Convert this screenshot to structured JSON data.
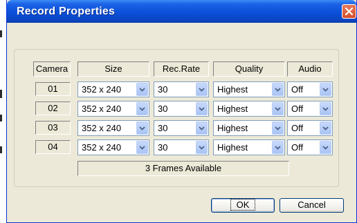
{
  "dialog": {
    "title": "Record Properties",
    "headers": {
      "camera": "Camera",
      "size": "Size",
      "rec_rate": "Rec.Rate",
      "quality": "Quality",
      "audio": "Audio"
    },
    "rows": [
      {
        "camera": "01",
        "size": "352 x 240",
        "rec_rate": "30",
        "quality": "Highest",
        "audio": "Off"
      },
      {
        "camera": "02",
        "size": "352 x 240",
        "rec_rate": "30",
        "quality": "Highest",
        "audio": "Off"
      },
      {
        "camera": "03",
        "size": "352 x 240",
        "rec_rate": "30",
        "quality": "Highest",
        "audio": "Off"
      },
      {
        "camera": "04",
        "size": "352 x 240",
        "rec_rate": "30",
        "quality": "Highest",
        "audio": "Off"
      }
    ],
    "status": "3 Frames Available",
    "ok_label": "OK",
    "cancel_label": "Cancel"
  },
  "icons": {
    "close": "close-icon",
    "dropdown": "chevron-down-icon"
  },
  "colors": {
    "titlebar": "#0a50d8",
    "dialog_bg": "#ece9d8",
    "close_button": "#d6502c",
    "combo_border": "#7f9db9",
    "combo_arrow": "#a9c4f5"
  }
}
